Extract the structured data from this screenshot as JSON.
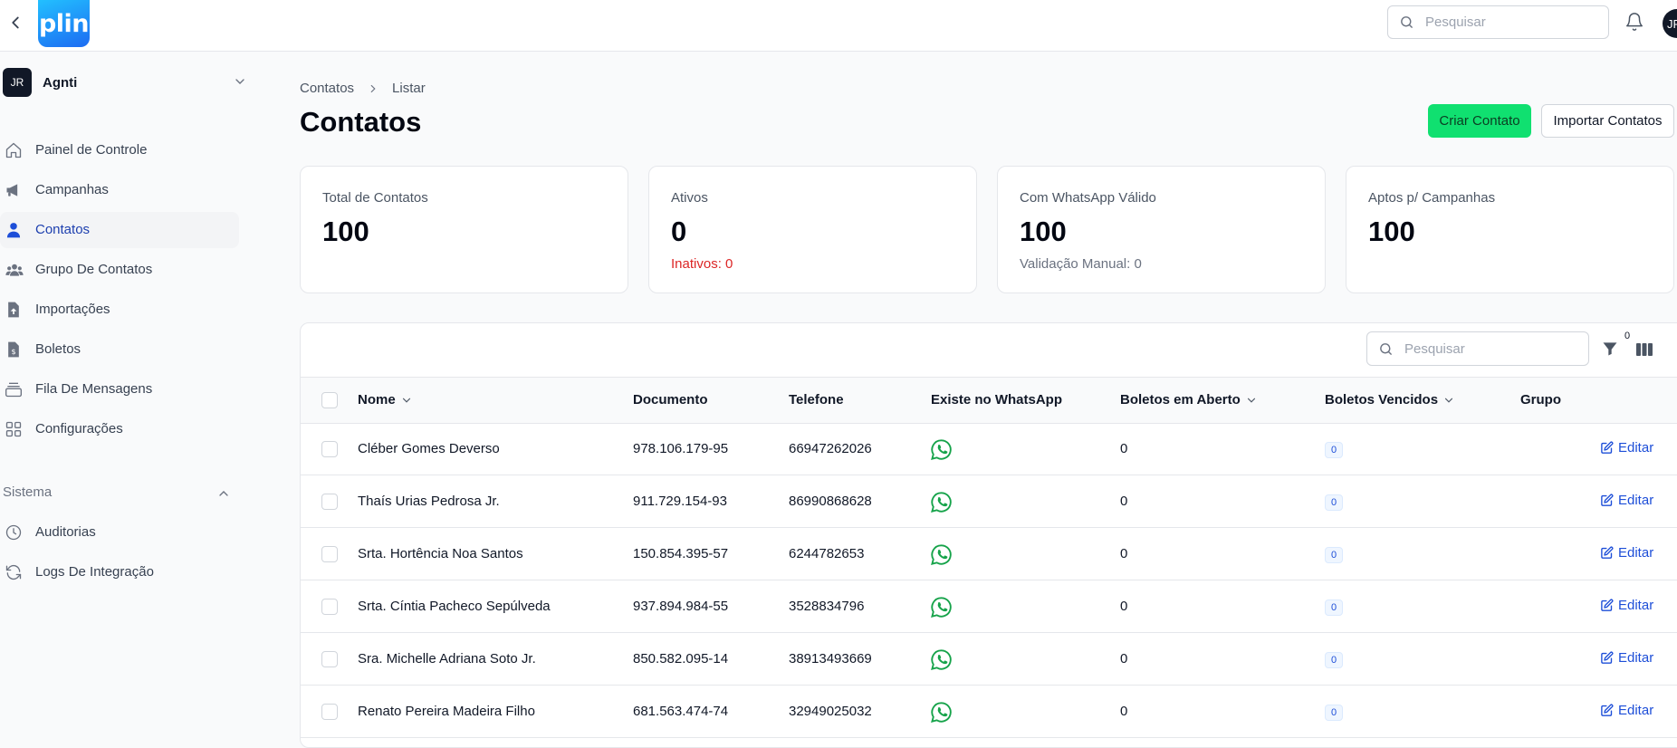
{
  "app": {
    "logo_text": "plin",
    "user_initials": "JR"
  },
  "topbar": {
    "search_placeholder": "Pesquisar"
  },
  "sidebar": {
    "org": {
      "initials": "JR",
      "name": "Agnti"
    },
    "items": [
      {
        "label": "Painel de Controle",
        "icon": "home-icon",
        "active": false
      },
      {
        "label": "Campanhas",
        "icon": "megaphone-icon",
        "active": false
      },
      {
        "label": "Contatos",
        "icon": "user-icon",
        "active": true
      },
      {
        "label": "Grupo De Contatos",
        "icon": "users-icon",
        "active": false
      },
      {
        "label": "Importações",
        "icon": "file-upload-icon",
        "active": false
      },
      {
        "label": "Boletos",
        "icon": "file-invoice-icon",
        "active": false
      },
      {
        "label": "Fila De Mensagens",
        "icon": "inbox-stack-icon",
        "active": false
      },
      {
        "label": "Configurações",
        "icon": "grid-icon",
        "active": false
      }
    ],
    "section_label": "Sistema",
    "system_items": [
      {
        "label": "Auditorias",
        "icon": "clock-icon"
      },
      {
        "label": "Logs De Integração",
        "icon": "refresh-icon"
      }
    ]
  },
  "breadcrumb": {
    "root": "Contatos",
    "current": "Listar"
  },
  "page": {
    "title": "Contatos",
    "create_button": "Criar Contato",
    "import_button": "Importar Contatos"
  },
  "stats": [
    {
      "label": "Total de Contatos",
      "value": "100",
      "sub": ""
    },
    {
      "label": "Ativos",
      "value": "0",
      "sub": "Inativos: 0"
    },
    {
      "label": "Com WhatsApp Válido",
      "value": "100",
      "sub": "Validação Manual: 0"
    },
    {
      "label": "Aptos p/ Campanhas",
      "value": "100",
      "sub": ""
    }
  ],
  "table": {
    "search_placeholder": "Pesquisar",
    "filter_count": "0",
    "columns": {
      "nome": "Nome",
      "documento": "Documento",
      "telefone": "Telefone",
      "whatsapp": "Existe no WhatsApp",
      "boletos_aberto": "Boletos em Aberto",
      "boletos_vencidos": "Boletos Vencidos",
      "grupo": "Grupo"
    },
    "edit_label": "Editar",
    "rows": [
      {
        "nome": "Cléber Gomes Deverso",
        "documento": "978.106.179-95",
        "telefone": "66947262026",
        "boletos_aberto": "0",
        "boletos_vencidos": "0"
      },
      {
        "nome": "Thaís Urias Pedrosa Jr.",
        "documento": "911.729.154-93",
        "telefone": "86990868628",
        "boletos_aberto": "0",
        "boletos_vencidos": "0"
      },
      {
        "nome": "Srta. Hortência Noa Santos",
        "documento": "150.854.395-57",
        "telefone": "6244782653",
        "boletos_aberto": "0",
        "boletos_vencidos": "0"
      },
      {
        "nome": "Srta. Cíntia Pacheco Sepúlveda",
        "documento": "937.894.984-55",
        "telefone": "3528834796",
        "boletos_aberto": "0",
        "boletos_vencidos": "0"
      },
      {
        "nome": "Sra. Michelle Adriana Soto Jr.",
        "documento": "850.582.095-14",
        "telefone": "38913493669",
        "boletos_aberto": "0",
        "boletos_vencidos": "0"
      },
      {
        "nome": "Renato Pereira Madeira Filho",
        "documento": "681.563.474-74",
        "telefone": "32949025032",
        "boletos_aberto": "0",
        "boletos_vencidos": "0"
      }
    ]
  },
  "colors": {
    "primary": "#10e070",
    "link": "#1d4ed8",
    "danger": "#dc2626",
    "whatsapp": "#22c55e"
  }
}
